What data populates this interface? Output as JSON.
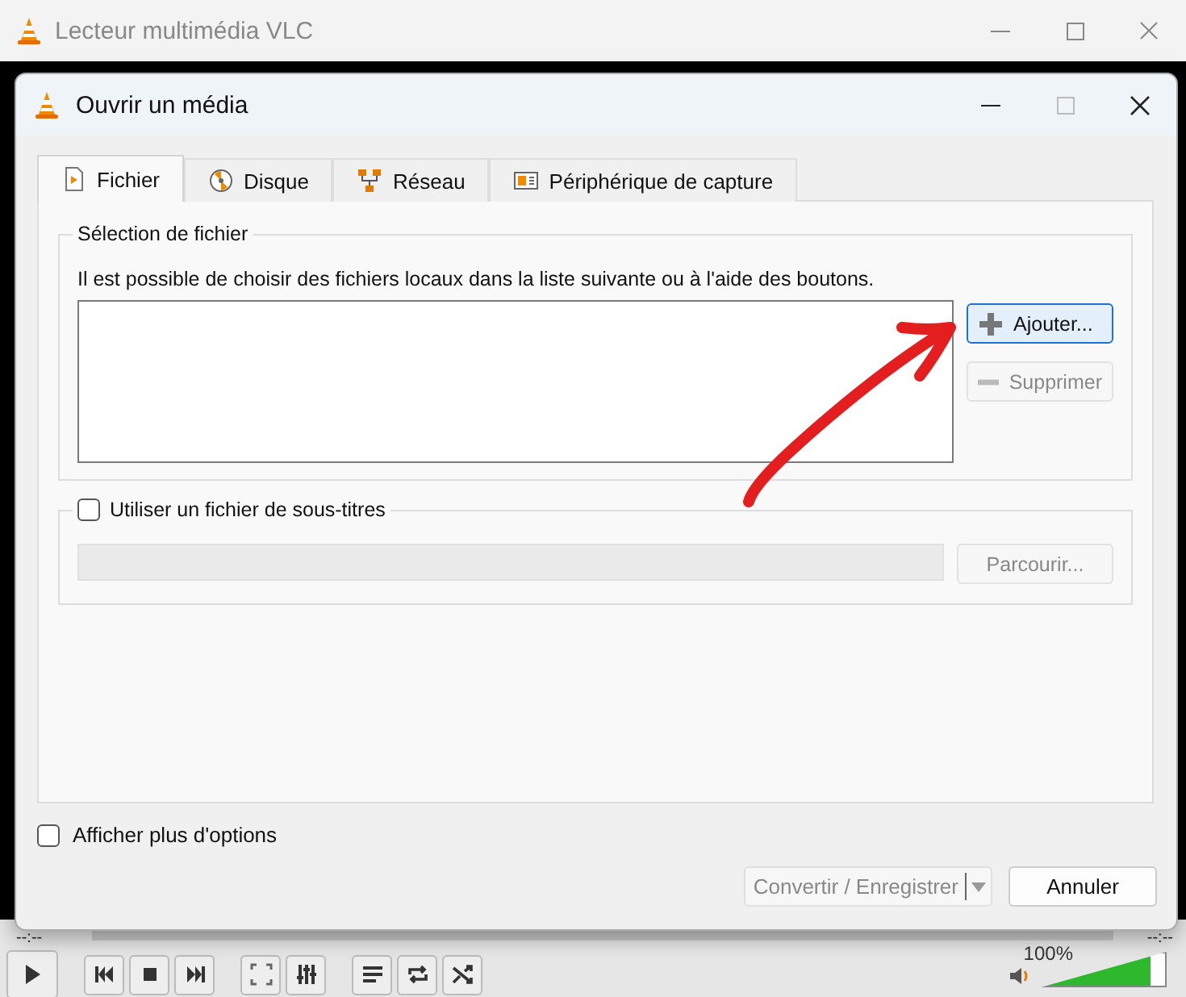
{
  "main_window": {
    "title": "Lecteur multimédia VLC",
    "time_elapsed": "--:--",
    "time_total": "--:--",
    "volume": {
      "reading": "100%",
      "level": 0.88
    }
  },
  "dialog": {
    "title": "Ouvrir un média",
    "tabs": [
      {
        "label": "Fichier",
        "selected": true
      },
      {
        "label": "Disque",
        "selected": false
      },
      {
        "label": "Réseau",
        "selected": false
      },
      {
        "label": "Périphérique de capture",
        "selected": false
      }
    ],
    "file_selection": {
      "title": "Sélection de fichier",
      "description": "Il est possible de choisir des fichiers locaux dans la liste suivante ou à l'aide des boutons.",
      "buttons": [
        {
          "label": "Ajouter...",
          "disabled": false,
          "kind": "add"
        },
        {
          "label": "Supprimer",
          "disabled": true,
          "kind": "remove"
        }
      ]
    },
    "subtitles": {
      "label": "Utiliser un fichier de sous-titres",
      "checked": false,
      "browse": {
        "label": "Parcourir...",
        "disabled": true
      }
    },
    "more_options": {
      "label": "Afficher plus d'options",
      "checked": false
    },
    "buttons": [
      {
        "label": "Convertir / Enregistrer",
        "disabled": true,
        "kind": "split"
      },
      {
        "label": "Annuler",
        "disabled": false,
        "kind": "plain"
      }
    ]
  }
}
